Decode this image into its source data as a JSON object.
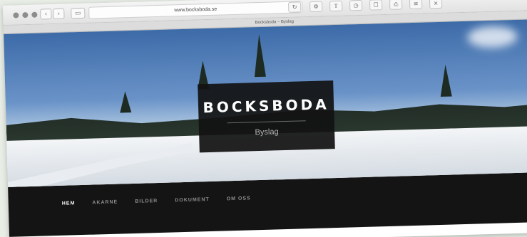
{
  "browser": {
    "url": "www.bocksboda.se",
    "tab_title": "Bocksboda – Byslag",
    "toolbar_icons": [
      "reload-icon",
      "gear-icon",
      "share-icon",
      "history-icon",
      "bookmark-icon",
      "print-icon",
      "reader-icon",
      "close-icon"
    ]
  },
  "site": {
    "title": "BOCKSBODA",
    "subtitle": "Byslag"
  },
  "nav": {
    "items": [
      {
        "label": "HEM",
        "active": true
      },
      {
        "label": "AKARNE",
        "active": false
      },
      {
        "label": "BILDER",
        "active": false
      },
      {
        "label": "DOKUMENT",
        "active": false
      },
      {
        "label": "OM OSS",
        "active": false
      }
    ]
  }
}
